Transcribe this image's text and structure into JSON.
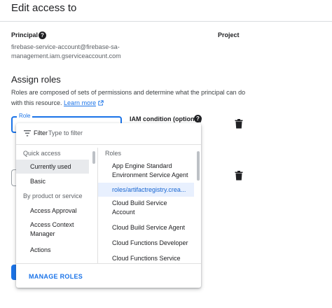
{
  "header": {
    "title": "Edit access to"
  },
  "principal": {
    "label": "Principal",
    "email_line1": "firebase-service-account@firebase-sa-",
    "email_line2": "management.iam.gserviceaccount.com"
  },
  "project": {
    "label": "Project"
  },
  "assign_roles": {
    "title": "Assign roles",
    "desc_line1": "Roles are composed of sets of permissions and determine what the principal can do",
    "desc_line2": "with this resource.",
    "learn_more": "Learn more"
  },
  "role_field": {
    "label": "Role"
  },
  "iam_condition": {
    "label": "IAM condition (optional)"
  },
  "dropdown": {
    "filter_label": "Filter",
    "filter_placeholder": "Type to filter",
    "left": {
      "quick_access": "Quick access",
      "currently_used": "Currently used",
      "basic": "Basic",
      "by_product": "By product or service",
      "access_approval": "Access Approval",
      "access_context_l1": "Access Context",
      "access_context_l2": "Manager",
      "actions": "Actions"
    },
    "right": {
      "header": "Roles",
      "r1_l1": "App Engine Standard",
      "r1_l2": "Environment Service Agent",
      "r2": "roles/artifactregistry.crea...",
      "r3_l1": "Cloud Build Service",
      "r3_l2": "Account",
      "r4": "Cloud Build Service Agent",
      "r5": "Cloud Functions Developer",
      "r6": "Cloud Functions Service"
    },
    "manage_roles": "MANAGE ROLES"
  },
  "colors": {
    "accent": "#1a73e8",
    "selected_bg": "#e8f0fe",
    "text": "#202124"
  }
}
